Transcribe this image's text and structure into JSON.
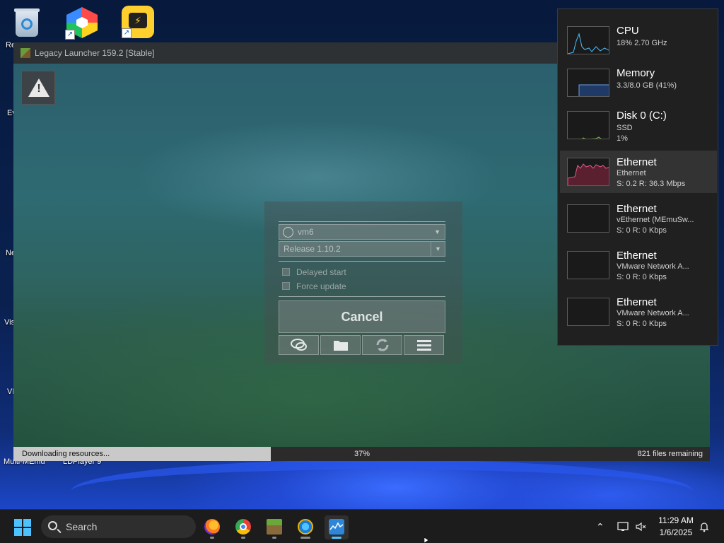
{
  "desktop": {
    "icons": [
      {
        "name": "recycle-bin",
        "label": "Re"
      },
      {
        "name": "multicolor-app",
        "label": ""
      },
      {
        "name": "ldplayer-shortcut",
        "label": ""
      }
    ],
    "left_fragments": [
      "Ev",
      "Ne",
      "Vis",
      "VI"
    ],
    "bottom_labels": [
      "Multi-MEmu",
      "LDPlayer 9"
    ]
  },
  "launcher": {
    "title": "Legacy Launcher 159.2 [Stable]",
    "account": "vm6",
    "version": "Release 1.10.2",
    "options": [
      {
        "label": "Delayed start",
        "checked": false
      },
      {
        "label": "Force update",
        "checked": false
      }
    ],
    "cancel_label": "Cancel",
    "tools": [
      "chat-icon",
      "folder-icon",
      "refresh-icon",
      "menu-icon"
    ],
    "progress": {
      "status": "Downloading resources...",
      "percent_label": "37%",
      "percent": 37,
      "remaining": "821 files remaining"
    }
  },
  "perf": {
    "items": [
      {
        "title": "CPU",
        "sub1": "18% 2.70 GHz",
        "sub2": "",
        "color": "#4cc2ff",
        "selected": false
      },
      {
        "title": "Memory",
        "sub1": "3.3/8.0 GB (41%)",
        "sub2": "",
        "color": "#6a9ee8",
        "selected": false
      },
      {
        "title": "Disk 0 (C:)",
        "sub1": "SSD",
        "sub2": "1%",
        "color": "#7bbd3e",
        "selected": false
      },
      {
        "title": "Ethernet",
        "sub1": "Ethernet",
        "sub2": "S: 0.2 R: 36.3 Mbps",
        "color": "#e35a8a",
        "selected": true
      },
      {
        "title": "Ethernet",
        "sub1": "vEthernet (MEmuSw...",
        "sub2": "S: 0 R: 0 Kbps",
        "color": "#e35a8a",
        "selected": false
      },
      {
        "title": "Ethernet",
        "sub1": "VMware Network A...",
        "sub2": "S: 0 R: 0 Kbps",
        "color": "#e35a8a",
        "selected": false
      },
      {
        "title": "Ethernet",
        "sub1": "VMware Network A...",
        "sub2": "S: 0 R: 0 Kbps",
        "color": "#e35a8a",
        "selected": false
      }
    ]
  },
  "taskbar": {
    "search_placeholder": "Search",
    "apps": [
      "firefox-icon",
      "chrome-icon",
      "minecraft-launcher-icon",
      "ie-style-app-icon",
      "task-manager-icon"
    ],
    "time": "11:29 AM",
    "date": "1/6/2025"
  }
}
